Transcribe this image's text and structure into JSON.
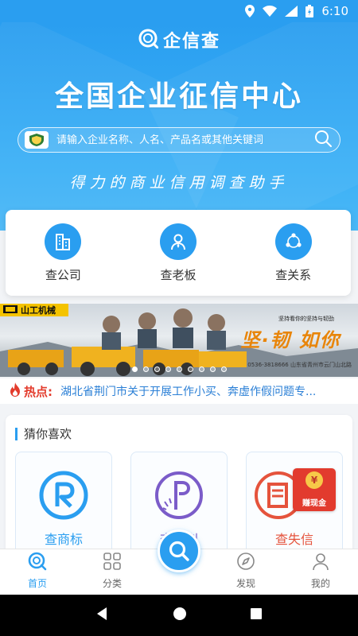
{
  "status_bar": {
    "time": "6:10"
  },
  "header": {
    "app_name": "企信查"
  },
  "hero": {
    "headline": "全国企业征信中心",
    "search_placeholder": "请输入企业名称、人名、产品名或其他关键词",
    "slogan": "得力的商业信用调查助手"
  },
  "features": [
    {
      "label": "查公司",
      "icon": "building-icon"
    },
    {
      "label": "查老板",
      "icon": "person-icon"
    },
    {
      "label": "查关系",
      "icon": "network-icon"
    }
  ],
  "banner": {
    "brand": "山工机械",
    "title": "坚·韧 如你",
    "subtitle": "坚持看你的坚持与韧劲",
    "footer": "0536-3818666 山东省青州市云门山北路",
    "slide_count": 9,
    "active_slide": 0
  },
  "hot": {
    "label": "热点:",
    "text": "湖北省荆门市关于开展工作小买、奔虚作假问题专..."
  },
  "guess": {
    "title": "猜你喜欢",
    "items": [
      {
        "label": "查商标",
        "icon": "trademark-icon",
        "color": "#2a9ef0"
      },
      {
        "label": "查专利",
        "icon": "patent-icon",
        "color": "#7b5cc9"
      },
      {
        "label": "查失信",
        "icon": "dishonest-icon",
        "color": "#e5533c"
      }
    ],
    "red_packet": {
      "label": "赚现金",
      "symbol": "¥"
    }
  },
  "tabbar": {
    "items": [
      {
        "label": "首页",
        "icon": "home-icon",
        "active": true
      },
      {
        "label": "分类",
        "icon": "grid-icon",
        "active": false
      },
      {
        "label": "发现",
        "icon": "compass-icon",
        "active": false
      },
      {
        "label": "我的",
        "icon": "user-icon",
        "active": false
      }
    ],
    "center_icon": "search-icon"
  },
  "colors": {
    "primary": "#2a9ef0",
    "hot_red": "#e33b2c",
    "link_blue": "#2a7fd6"
  }
}
